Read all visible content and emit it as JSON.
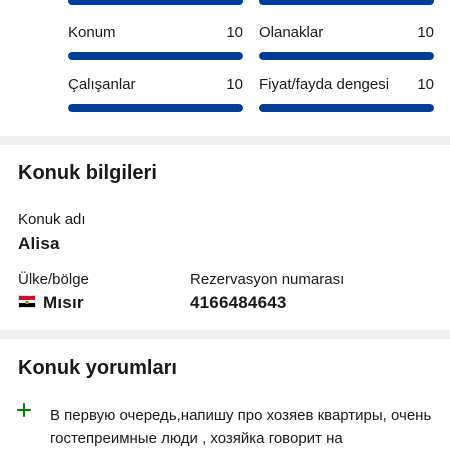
{
  "scores": {
    "items": [
      {
        "label": "Konum",
        "value": "10",
        "fraction": 1.0
      },
      {
        "label": "Olanaklar",
        "value": "10",
        "fraction": 1.0
      },
      {
        "label": "Çalışanlar",
        "value": "10",
        "fraction": 1.0
      },
      {
        "label": "Fiyat/fayda dengesi",
        "value": "10",
        "fraction": 1.0
      }
    ]
  },
  "guest_info": {
    "title": "Konuk bilgileri",
    "name_label": "Konuk adı",
    "name_value": "Alisa",
    "country_label": "Ülke/bölge",
    "country_value": "Mısır",
    "reservation_label": "Rezervasyon numarası",
    "reservation_value": "4166484643"
  },
  "reviews": {
    "title": "Konuk yorumları",
    "positive_text": "В первую очередь,напишу про хозяев квартиры, очень гостепреимные люди , хозяйка говорит на"
  },
  "colors": {
    "accent": "#003b95",
    "positive": "#008009",
    "divider": "#f0f0f0"
  }
}
